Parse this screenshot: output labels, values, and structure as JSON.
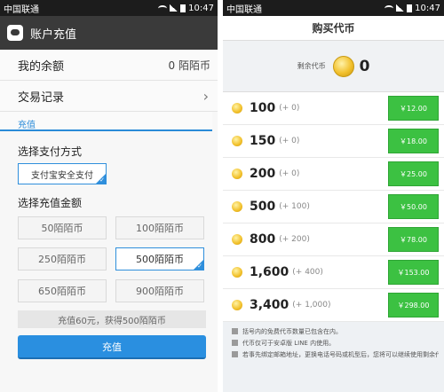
{
  "left": {
    "status": {
      "carrier": "中国联通",
      "time": "10:47"
    },
    "appbar_title": "账户充值",
    "balance": {
      "label": "我的余额",
      "value": "0 陌陌币"
    },
    "history_label": "交易记录",
    "section_label": "充值",
    "payment": {
      "title": "选择支付方式",
      "option": "支付宝安全支付"
    },
    "amounts": {
      "title": "选择充值金额",
      "options": [
        "50陌陌币",
        "100陌陌币",
        "250陌陌币",
        "500陌陌币",
        "650陌陌币",
        "900陌陌币"
      ],
      "selected": "500陌陌币"
    },
    "summary": "充值60元，获得500陌陌币",
    "submit_label": "充值"
  },
  "right": {
    "status": {
      "carrier": "中国联通",
      "time": "10:47"
    },
    "title": "购买代币",
    "balance_label": "剩余代币",
    "balance_value": "0",
    "packages": [
      {
        "amount": "100",
        "bonus": "(+ 0)",
        "price": "￥12.00"
      },
      {
        "amount": "150",
        "bonus": "(+ 0)",
        "price": "￥18.00"
      },
      {
        "amount": "200",
        "bonus": "(+ 0)",
        "price": "￥25.00"
      },
      {
        "amount": "500",
        "bonus": "(+ 100)",
        "price": "￥50.00"
      },
      {
        "amount": "800",
        "bonus": "(+ 200)",
        "price": "￥78.00"
      },
      {
        "amount": "1,600",
        "bonus": "(+ 400)",
        "price": "￥153.00"
      },
      {
        "amount": "3,400",
        "bonus": "(+ 1,000)",
        "price": "￥298.00"
      }
    ],
    "notes": [
      "括号内的免费代币数量已包含在内。",
      "代币仅可于安卓版 LINE 内使用。",
      "若事先绑定邮箱地址，更换电话号码或机型后，您将可以继续使用剩余代币。"
    ]
  },
  "colors": {
    "accent_blue": "#2a8fe0",
    "buy_green": "#3cc142",
    "coin_gold": "#f2c12e"
  },
  "icons": [
    "app-icon",
    "chevron-right-icon",
    "check-corner-icon",
    "coin-icon",
    "note-icon"
  ]
}
